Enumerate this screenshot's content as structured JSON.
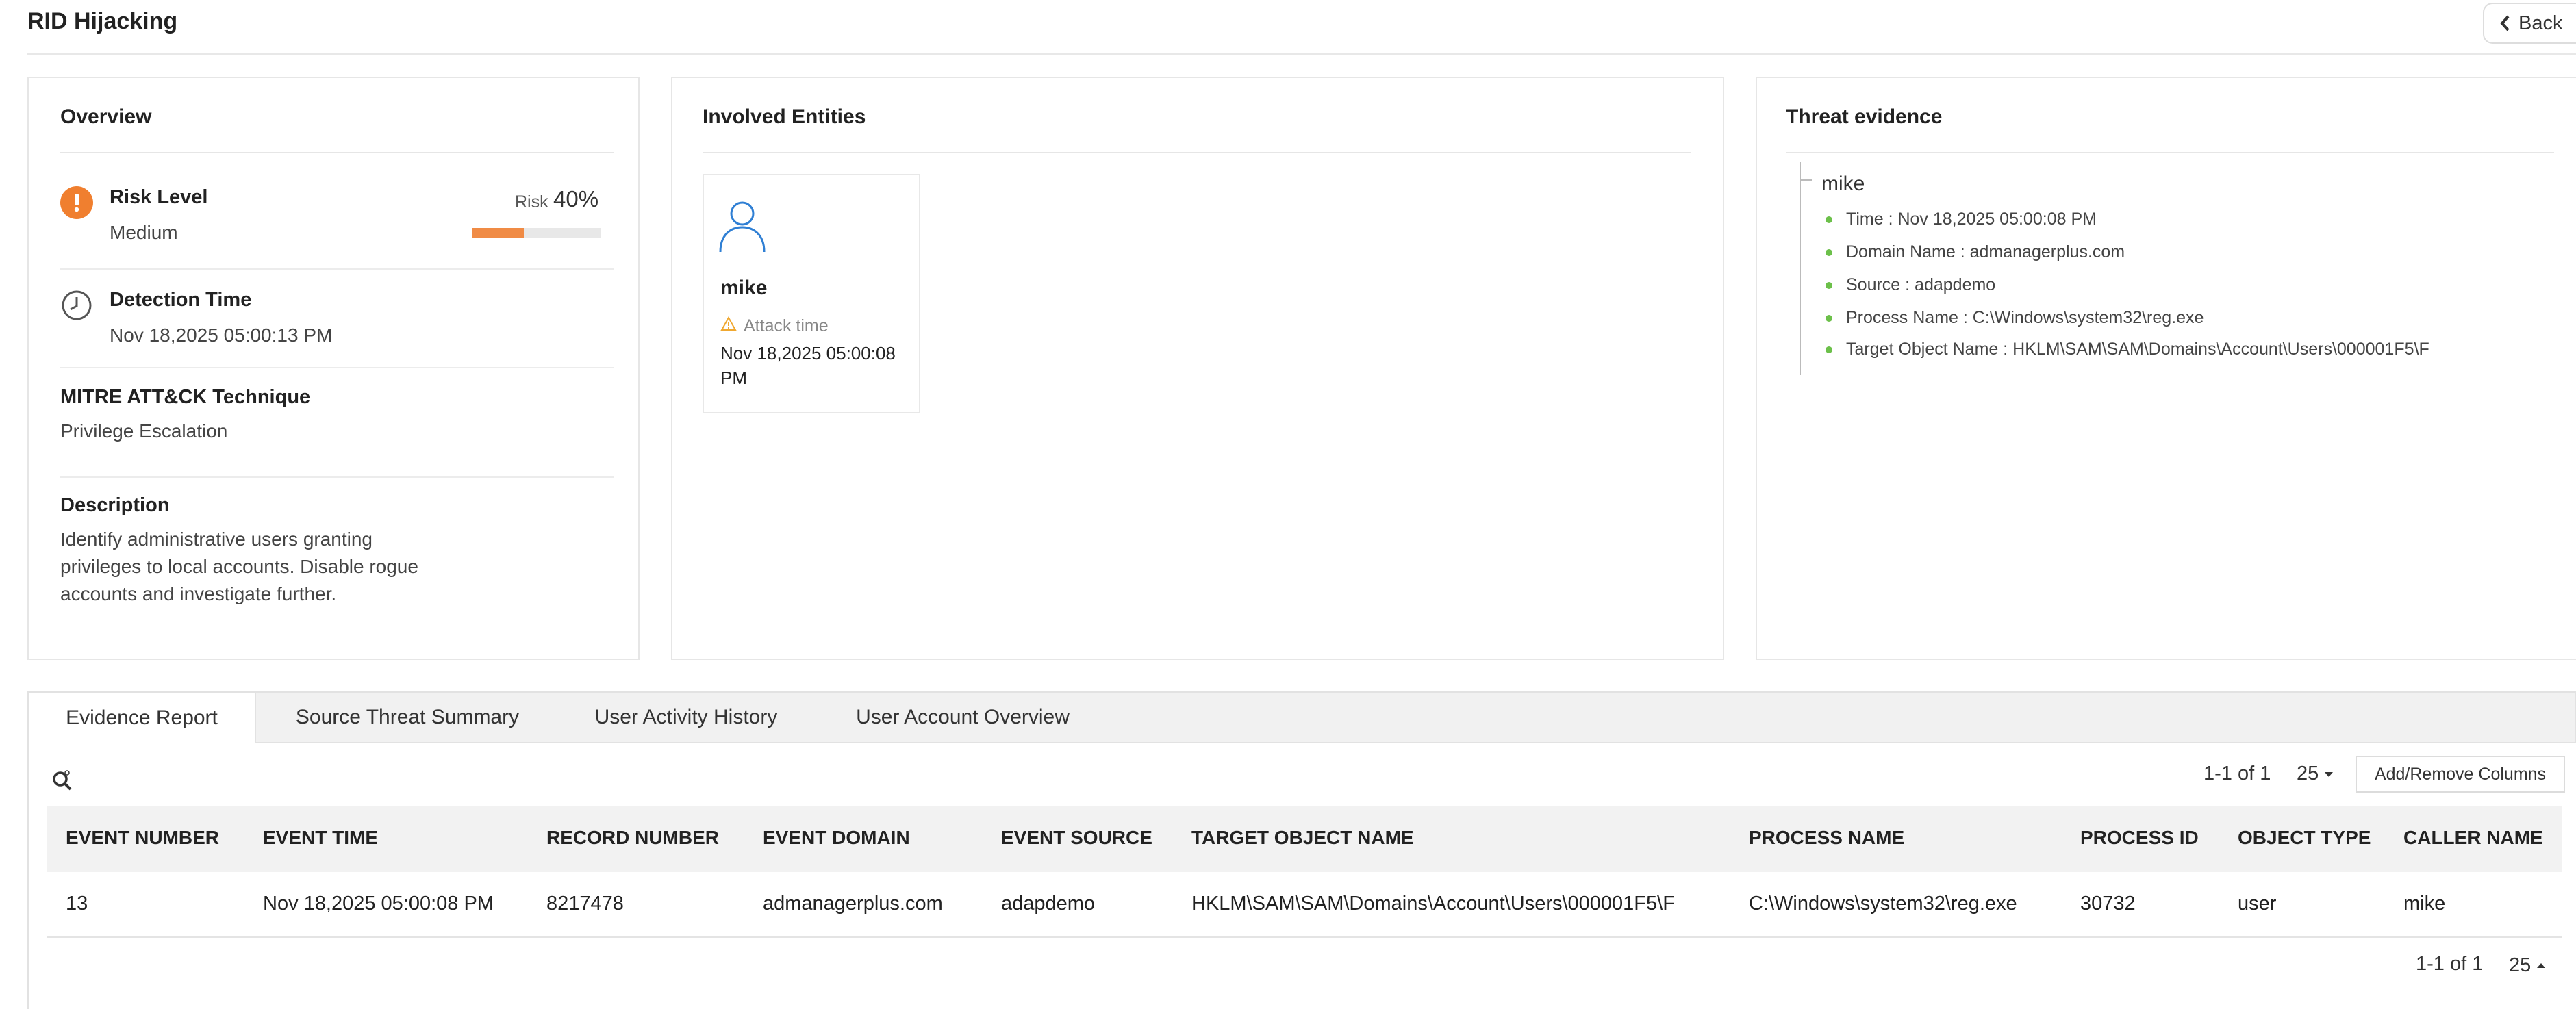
{
  "page": {
    "title": "RID Hijacking",
    "back_label": "Back"
  },
  "overview": {
    "title": "Overview",
    "risk": {
      "label": "Risk Level",
      "value": "Medium",
      "risk_word": "Risk",
      "percent_text": "40%",
      "percent": 40,
      "bar_color": "#f08b45",
      "icon": "exclamation-icon"
    },
    "detection": {
      "label": "Detection Time",
      "value": "Nov 18,2025 05:00:13 PM",
      "icon": "clock-icon"
    },
    "mitre": {
      "label": "MITRE ATT&CK Technique",
      "value": "Privilege Escalation"
    },
    "description": {
      "label": "Description",
      "value": "Identify administrative users granting privileges to local accounts. Disable rogue accounts and investigate further."
    }
  },
  "entities": {
    "title": "Involved Entities",
    "items": [
      {
        "name": "mike",
        "attack_label": "Attack time",
        "attack_time": "Nov 18,2025 05:00:08 PM",
        "icon": "user-icon"
      }
    ]
  },
  "threat_evidence": {
    "title": "Threat evidence",
    "user": "mike",
    "items": [
      "Time : Nov 18,2025 05:00:08 PM",
      "Domain Name : admanagerplus.com",
      "Source : adapdemo",
      "Process Name : C:\\Windows\\system32\\reg.exe",
      "Target Object Name : HKLM\\SAM\\SAM\\Domains\\Account\\Users\\000001F5\\F"
    ]
  },
  "tabs": [
    "Evidence Report",
    "Source Threat Summary",
    "User Activity History",
    "User Account Overview"
  ],
  "active_tab": "Evidence Report",
  "table": {
    "pager_top": "1-1 of 1",
    "page_size": "25",
    "add_remove_label": "Add/Remove Columns",
    "columns": [
      "EVENT NUMBER",
      "EVENT TIME",
      "RECORD NUMBER",
      "EVENT DOMAIN",
      "EVENT SOURCE",
      "TARGET OBJECT NAME",
      "PROCESS NAME",
      "PROCESS ID",
      "OBJECT TYPE",
      "CALLER NAME"
    ],
    "rows": [
      [
        "13",
        "Nov 18,2025 05:00:08 PM",
        "8217478",
        "admanagerplus.com",
        "adapdemo",
        "HKLM\\SAM\\SAM\\Domains\\Account\\Users\\000001F5\\F",
        "C:\\Windows\\system32\\reg.exe",
        "30732",
        "user",
        "mike"
      ]
    ],
    "pager_bottom": "1-1 of 1",
    "page_size_bottom": "25"
  },
  "colors": {
    "accent_orange": "#f07f2f",
    "user_icon_blue": "#2f7fd4",
    "evidence_bullet_green": "#6cc04a"
  }
}
